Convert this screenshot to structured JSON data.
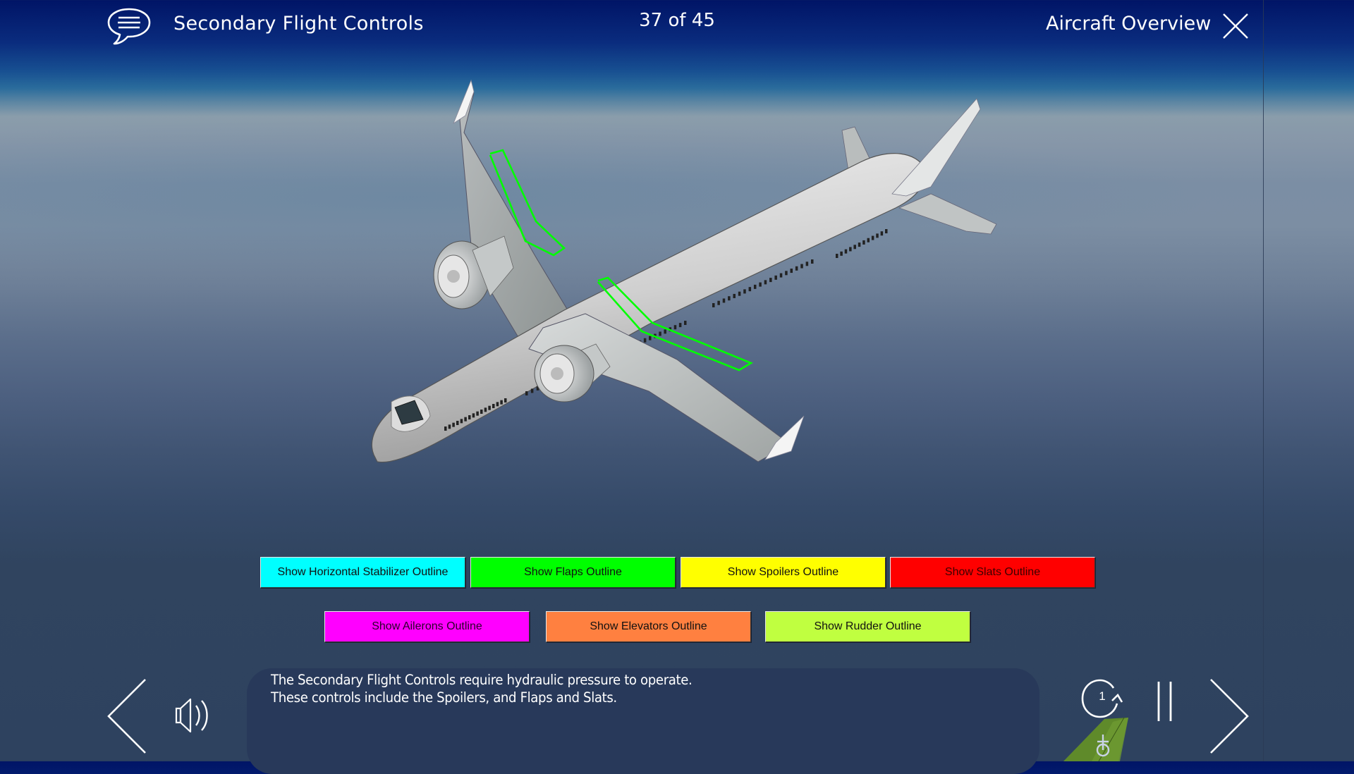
{
  "header": {
    "transcript_icon": "speech-bubble-icon",
    "title": "Secondary Flight Controls",
    "page_counter": "37 of 45",
    "page_current": 37,
    "page_total": 45,
    "overview_label": "Aircraft Overview",
    "close_icon": "close-x-icon"
  },
  "scene": {
    "subject": "3D airplane model with flaps outlined in green",
    "highlight_color": "#00ff00"
  },
  "buttons": {
    "row1": [
      {
        "label": "Show Horizontal Stabilizer Outline",
        "color": "#00ffff",
        "text_color": "#111111"
      },
      {
        "label": "Show Flaps Outline",
        "color": "#00ff00",
        "text_color": "#111111"
      },
      {
        "label": "Show Spoilers Outline",
        "color": "#ffff00",
        "text_color": "#111111"
      },
      {
        "label": "Show Slats Outline",
        "color": "#ff0000",
        "text_color": "#3a0000"
      }
    ],
    "row2": [
      {
        "label": "Show Ailerons Outline",
        "color": "#ff00ff",
        "text_color": "#2a002a"
      },
      {
        "label": "Show Elevators Outline",
        "color": "#ff8040",
        "text_color": "#111111"
      },
      {
        "label": "Show Rudder Outline",
        "color": "#c0ff40",
        "text_color": "#111111"
      }
    ]
  },
  "narration": {
    "lines": [
      "The Secondary Flight Controls require hydraulic pressure to operate.",
      "These controls include the Spoilers, and Flaps and Slats."
    ]
  },
  "player": {
    "back_icon": "chevron-left-icon",
    "audio_icon": "speaker-icon",
    "replay_icon": "replay-icon",
    "replay_count": "1",
    "pause_icon": "pause-icon",
    "next_icon": "chevron-right-icon",
    "logo": "green-tail-fin-logo"
  }
}
